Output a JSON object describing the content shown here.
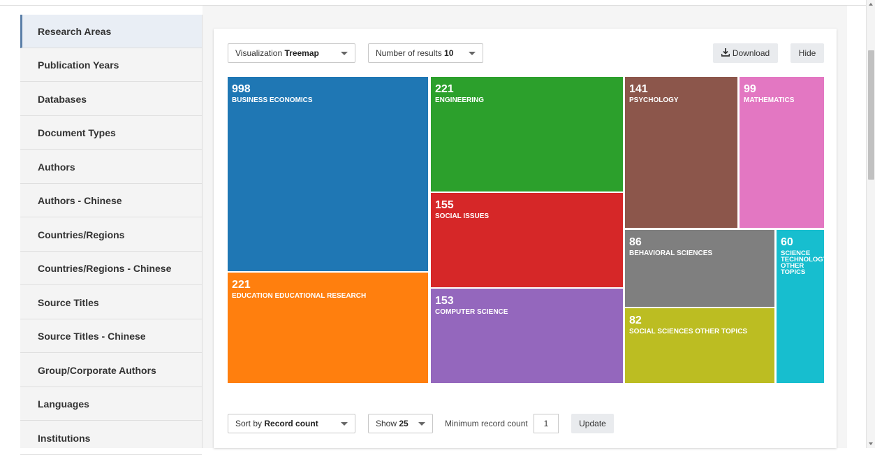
{
  "sidebar": {
    "items": [
      {
        "label": "Research Areas",
        "active": true
      },
      {
        "label": "Publication Years"
      },
      {
        "label": "Databases"
      },
      {
        "label": "Document Types"
      },
      {
        "label": "Authors"
      },
      {
        "label": "Authors - Chinese"
      },
      {
        "label": "Countries/Regions"
      },
      {
        "label": "Countries/Regions - Chinese"
      },
      {
        "label": "Source Titles"
      },
      {
        "label": "Source Titles - Chinese"
      },
      {
        "label": "Group/Corporate Authors"
      },
      {
        "label": "Languages"
      },
      {
        "label": "Institutions"
      }
    ]
  },
  "toolbar": {
    "visualization_prefix": "Visualization",
    "visualization_value": "Treemap",
    "results_prefix": "Number of results",
    "results_value": "10",
    "download_label": "Download",
    "hide_label": "Hide"
  },
  "treemap": {
    "cells": [
      {
        "count": "998",
        "label": "BUSINESS ECONOMICS",
        "color": "#1f77b4"
      },
      {
        "count": "221",
        "label": "EDUCATION EDUCATIONAL RESEARCH",
        "color": "#ff7f0e"
      },
      {
        "count": "221",
        "label": "ENGINEERING",
        "color": "#2ca02c"
      },
      {
        "count": "155",
        "label": "SOCIAL ISSUES",
        "color": "#d62728"
      },
      {
        "count": "153",
        "label": "COMPUTER SCIENCE",
        "color": "#9467bd"
      },
      {
        "count": "141",
        "label": "PSYCHOLOGY",
        "color": "#8c564b"
      },
      {
        "count": "99",
        "label": "MATHEMATICS",
        "color": "#e377c2"
      },
      {
        "count": "86",
        "label": "BEHAVIORAL SCIENCES",
        "color": "#7f7f7f"
      },
      {
        "count": "82",
        "label": "SOCIAL SCIENCES OTHER TOPICS",
        "color": "#bcbd22"
      },
      {
        "count": "60",
        "label": "SCIENCE TECHNOLOGY OTHER TOPICS",
        "color": "#17becf"
      }
    ]
  },
  "table_controls": {
    "sort_prefix": "Sort by",
    "sort_value": "Record count",
    "show_prefix": "Show",
    "show_value": "25",
    "min_label": "Minimum record count",
    "min_value": "1",
    "update_label": "Update"
  }
}
